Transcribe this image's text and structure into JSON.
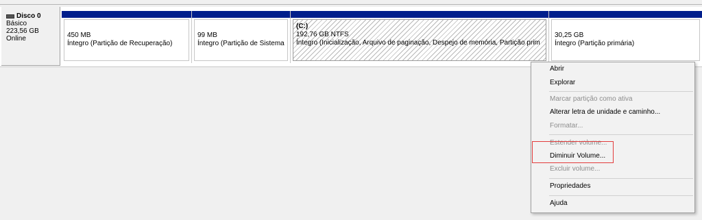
{
  "disk": {
    "name": "Disco 0",
    "type": "Básico",
    "size": "223,56 GB",
    "status": "Online",
    "icon": "disk-icon"
  },
  "partitions": [
    {
      "name": "",
      "size": "450 MB",
      "status": "Íntegro (Partição de Recuperação)"
    },
    {
      "name": "",
      "size": "99 MB",
      "status": "Íntegro (Partição de Sistema"
    },
    {
      "name": "(C:)",
      "size": "192,76 GB NTFS",
      "status": "Íntegro (Inicialização, Arquivo de paginação, Despejo de memória, Partição prim"
    },
    {
      "name": "",
      "size": "30,25 GB",
      "status": "Íntegro (Partição primária)"
    }
  ],
  "context_menu": {
    "items": [
      {
        "label": "Abrir",
        "enabled": true
      },
      {
        "label": "Explorar",
        "enabled": true
      },
      {
        "label": "Marcar partição como ativa",
        "enabled": false
      },
      {
        "label": "Alterar letra de unidade e caminho...",
        "enabled": true
      },
      {
        "label": "Formatar...",
        "enabled": false
      },
      {
        "label": "Estender volume...",
        "enabled": false
      },
      {
        "label": "Diminuir Volume...",
        "enabled": true
      },
      {
        "label": "Excluir volume...",
        "enabled": false
      },
      {
        "label": "Propriedades",
        "enabled": true
      },
      {
        "label": "Ajuda",
        "enabled": true
      }
    ]
  },
  "colors": {
    "partition_header": "#001e8c",
    "highlight_box": "#e23b3b",
    "disabled_text": "#8d8d8d"
  }
}
